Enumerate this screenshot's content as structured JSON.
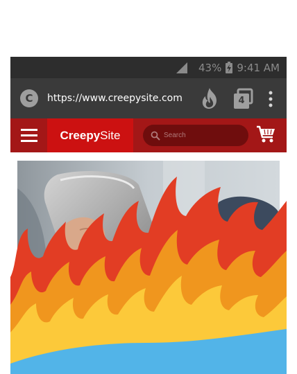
{
  "status_bar": {
    "battery": "43%",
    "time": "9:41 AM"
  },
  "browser": {
    "site_icon_letter": "C",
    "url": "https://www.creepysite.com",
    "tab_count": "4"
  },
  "site_header": {
    "brand_bold": "Creepy",
    "brand_light": "Site",
    "search_placeholder": "Search"
  },
  "hero": {
    "description": "hand-holding-phone-photo"
  },
  "colors": {
    "status_bar_bg": "#2d2d2d",
    "browser_bar_bg": "#3a3a3a",
    "header_bg": "#a31717",
    "brand_bg": "#cc1111",
    "search_bg": "#6f0d0d",
    "flame_outer": "#e23d24",
    "flame_mid": "#f0961e",
    "flame_inner": "#fcc93a",
    "sky_blue": "#52b4e8"
  },
  "icons": {
    "signal": "signal-icon",
    "battery": "battery-icon",
    "fire": "fire-icon",
    "tabs": "tabs-icon",
    "menu": "more-vert-icon",
    "hamburger": "hamburger-icon",
    "search": "search-icon",
    "cart": "cart-icon"
  }
}
